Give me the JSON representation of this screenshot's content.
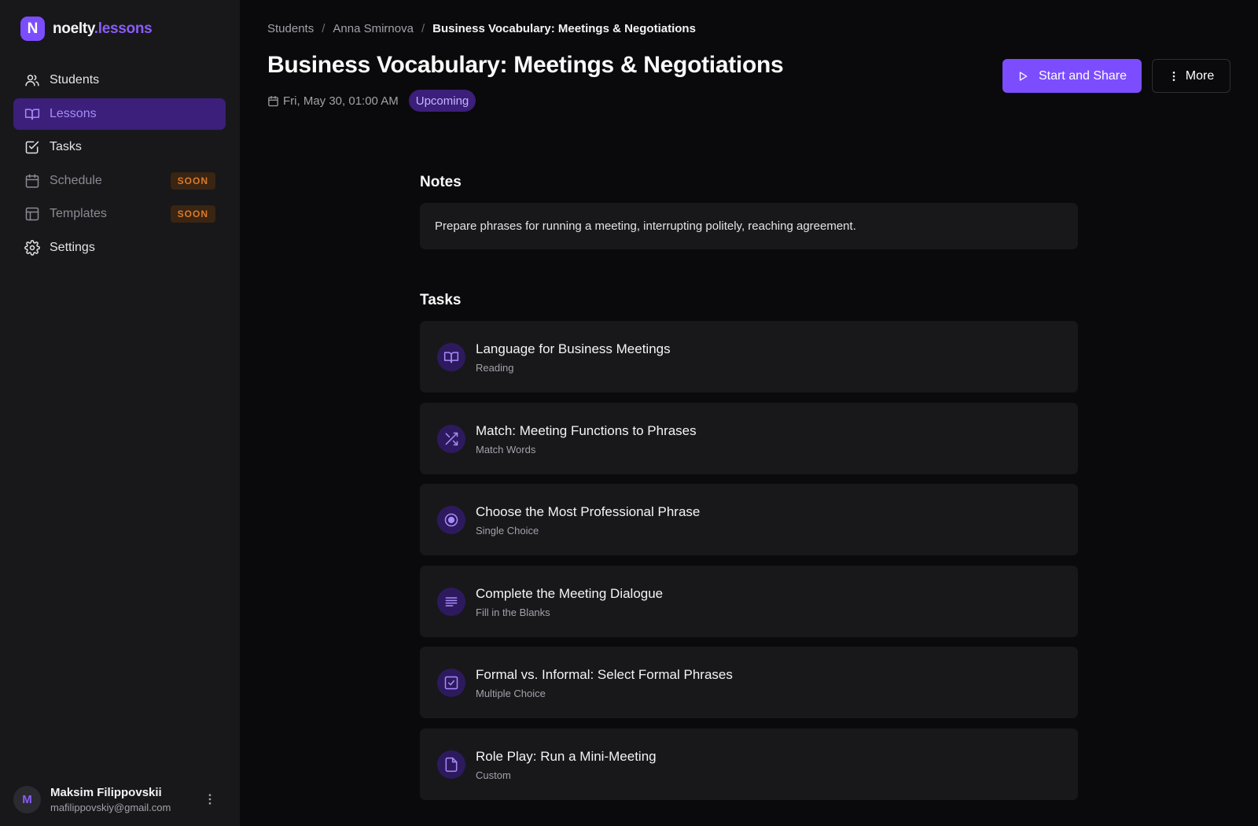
{
  "brand": {
    "logo_letter": "N",
    "name_main": "noelty",
    "name_accent": ".lessons",
    "color": "#7c4dff"
  },
  "sidebar": {
    "items": [
      {
        "label": "Students",
        "icon": "users-icon"
      },
      {
        "label": "Lessons",
        "icon": "book-open-icon",
        "active": true
      },
      {
        "label": "Tasks",
        "icon": "check-square-icon"
      },
      {
        "label": "Schedule",
        "icon": "calendar-icon",
        "badge": "SOON"
      },
      {
        "label": "Templates",
        "icon": "layout-icon",
        "badge": "SOON"
      },
      {
        "label": "Settings",
        "icon": "gear-icon"
      }
    ]
  },
  "user": {
    "initial": "M",
    "name": "Maksim Filippovskii",
    "email": "mafilippovskiy@gmail.com"
  },
  "breadcrumb": {
    "items": [
      "Students",
      "Anna Smirnova"
    ],
    "separator": "/",
    "current": "Business Vocabulary: Meetings & Negotiations"
  },
  "lesson": {
    "title": "Business Vocabulary: Meetings & Negotiations",
    "datetime": "Fri, May 30, 01:00 AM",
    "status": "Upcoming"
  },
  "actions": {
    "start_label": "Start and Share",
    "more_label": "More"
  },
  "notes": {
    "heading": "Notes",
    "text": "Prepare phrases for running a meeting, interrupting politely, reaching agreement."
  },
  "tasks": {
    "heading": "Tasks",
    "items": [
      {
        "title": "Language for Business Meetings",
        "type": "Reading",
        "icon": "book-open-icon"
      },
      {
        "title": "Match: Meeting Functions to Phrases",
        "type": "Match Words",
        "icon": "shuffle-icon"
      },
      {
        "title": "Choose the Most Professional Phrase",
        "type": "Single Choice",
        "icon": "radio-icon"
      },
      {
        "title": "Complete the Meeting Dialogue",
        "type": "Fill in the Blanks",
        "icon": "text-lines-icon"
      },
      {
        "title": "Formal vs. Informal: Select Formal Phrases",
        "type": "Multiple Choice",
        "icon": "checkbox-icon"
      },
      {
        "title": "Role Play: Run a Mini-Meeting",
        "type": "Custom",
        "icon": "file-icon"
      }
    ]
  },
  "colors": {
    "accent": "#7c4dff",
    "soon": "#d97a2b",
    "background": "#0a0a0c",
    "surface": "#18181b"
  }
}
